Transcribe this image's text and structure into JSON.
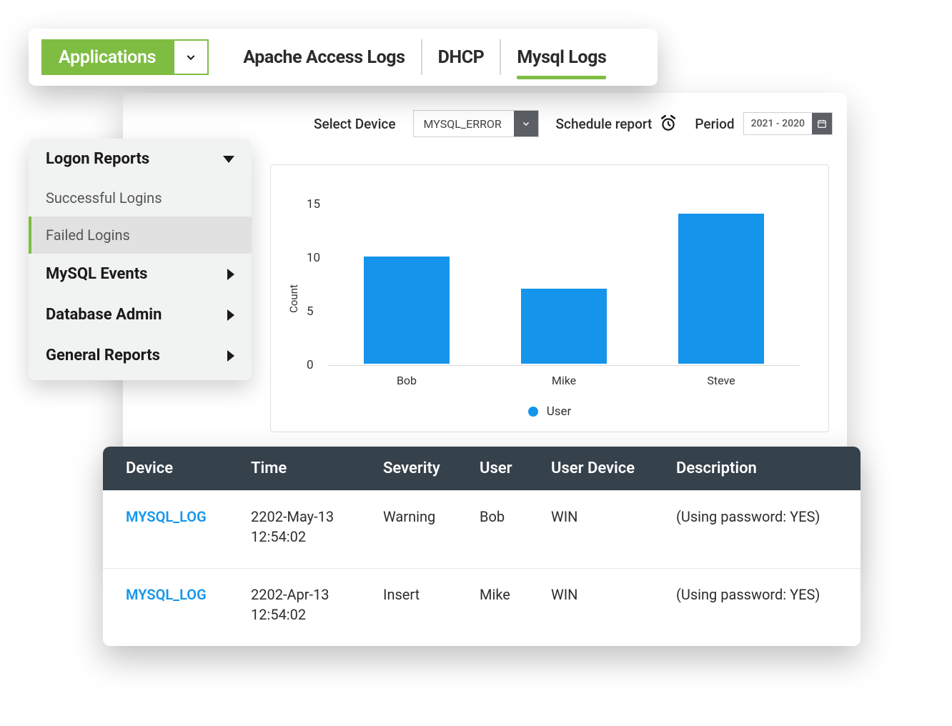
{
  "topbar": {
    "dropdown_label": "Applications",
    "tabs": [
      {
        "label": "Apache Access Logs",
        "active": false
      },
      {
        "label": "DHCP",
        "active": false
      },
      {
        "label": "Mysql Logs",
        "active": true
      }
    ]
  },
  "controls": {
    "device_label": "Select Device",
    "device_value": "MYSQL_ERROR",
    "schedule_label": "Schedule report",
    "period_label": "Period",
    "period_value": "2021 - 2020"
  },
  "sidebar": {
    "group_expanded": "Logon Reports",
    "items": [
      {
        "label": "Successful Logins",
        "active": false
      },
      {
        "label": "Failed Logins",
        "active": true
      }
    ],
    "groups_collapsed": [
      "MySQL Events",
      "Database Admin",
      "General Reports"
    ]
  },
  "chart_data": {
    "type": "bar",
    "categories": [
      "Bob",
      "Mike",
      "Steve"
    ],
    "values": [
      10,
      7,
      14
    ],
    "ylabel": "Count",
    "ylim": [
      0,
      15
    ],
    "yticks": [
      0,
      5,
      10,
      15
    ],
    "legend": "User",
    "bar_color": "#1495eb"
  },
  "table": {
    "columns": [
      "Device",
      "Time",
      "Severity",
      "User",
      "User Device",
      "Description"
    ],
    "rows": [
      {
        "device": "MYSQL_LOG",
        "time_date": "2202-May-13",
        "time_clock": "12:54:02",
        "severity": "Warning",
        "user": "Bob",
        "user_device": "WIN",
        "description": "(Using password: YES)"
      },
      {
        "device": "MYSQL_LOG",
        "time_date": "2202-Apr-13",
        "time_clock": "12:54:02",
        "severity": "Insert",
        "user": "Mike",
        "user_device": "WIN",
        "description": "(Using password: YES)"
      }
    ]
  }
}
